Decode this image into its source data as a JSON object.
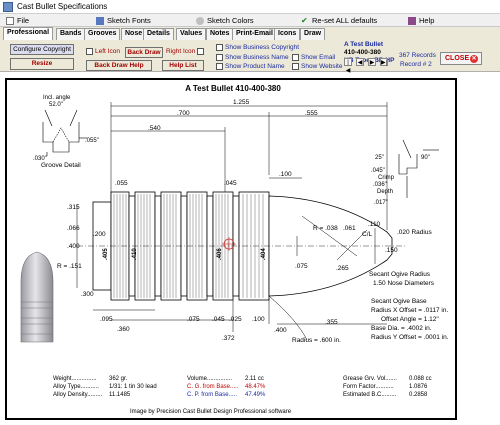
{
  "window": {
    "title": "Cast Bullet Specifications"
  },
  "menu": {
    "file": "File",
    "sketch_fonts": "Sketch Fonts",
    "sketch_colors": "Sketch Colors",
    "reset": "Re-set ALL defaults",
    "help": "Help"
  },
  "tabs": [
    "Professional",
    "Bands",
    "Grooves",
    "Nose",
    "Details",
    "Values",
    "Notes",
    "Print-Email",
    "Icons",
    "Draw"
  ],
  "toolbar": {
    "configure_copyright": "Configure Copyright",
    "resize": "Resize",
    "left_icon": "Left Icon",
    "back_draw": "Back Draw",
    "right_icon": "Right Icon",
    "back_draw_help": "Back Draw Help",
    "help_list": "Help List",
    "show_business_copyright": "Show Business Copyright",
    "show_business_name": "Show Business Name",
    "show_product_name": "Show Product Name",
    "show_email": "Show Email",
    "show_website": "Show Website",
    "close": "CLOSE"
  },
  "record_info": {
    "name": "A Test Bullet",
    "part": "410-400-380",
    "style": "HB Taper BB HP",
    "records": "367 Records",
    "record": "Record # 2"
  },
  "drawing": {
    "title": "A Test Bullet  410-400-380",
    "groove_detail": {
      "angle_label": "Incl. angle",
      "angle_value": "52.0\"",
      "depth": ".055\"",
      "width": ".030\"",
      "caption": "Groove Detail"
    },
    "crimp_detail": {
      "angle": "25\"",
      "angle2": "90\"",
      "crimp_value": ".045\"",
      "crimp_label": "Crimp",
      "depth_value": ".036\"",
      "depth_label": "Depth",
      "bottom": ".017\""
    },
    "dims": {
      "overall": "1.255",
      "d700": ".700",
      "d555": ".555",
      "d540": ".540",
      "d100": ".100",
      "d055": ".055",
      "d045": ".045",
      "d315": ".315",
      "d066": ".066",
      "d400": ".400",
      "d200": ".200",
      "r151": "R = .151",
      "d300": ".300",
      "d095": ".095",
      "d360": ".360",
      "d075": ".075",
      "d045b": ".045",
      "d025": ".025",
      "d100b": ".100",
      "d372": ".372",
      "r038": "R = .038",
      "d061": ".061",
      "cl": "C/L",
      "d110": ".110",
      "r020": ".020 Radius",
      "d150": ".150",
      "d265": ".265",
      "d075b": ".075",
      "d400b": ".400",
      "d355": ".355",
      "radius600": "Radius = .600 in.",
      "band410": ".410",
      "band406": ".406",
      "band404": ".404",
      "band405": ".405"
    },
    "secant_ogive": {
      "line1": "Secant Ogive Radius",
      "line2": "1.50  Nose Diameters"
    },
    "secant_base": {
      "line1": "Secant Ogive Base",
      "line2": "Radius X Offset = .0117 in.",
      "line3": "Offset Angle = 1.12\"",
      "line4": "Base Dia. = .4002 in.",
      "line5": "Radius Y Offset = .0001 in."
    }
  },
  "stats": {
    "weight_label": "Weight...............",
    "weight": "362 gr.",
    "alloy_type_label": "Alloy Type...........",
    "alloy_type": "1/31:  1 tin 30 lead",
    "alloy_density_label": "Alloy Density.........",
    "alloy_density": "11.1485",
    "volume_label": "Volume...............",
    "volume": "2.11 cc",
    "cg_label": "C. G. from Base.....",
    "cg": "48.47%",
    "cp_label": "C. P. from Base.....",
    "cp": "47.49%",
    "grease_label": "Grease Grv. Vol.......",
    "grease": "0.088 cc",
    "form_label": "Form Factor...........",
    "form": "1.0876",
    "bc_label": "Estimated B.C.........",
    "bc": "0.2858"
  },
  "credit": "Image by Precision Cast Bullet Design Professional software",
  "colors": {
    "accent_blue": "#1a2aa0",
    "alert_red": "#c00000"
  }
}
